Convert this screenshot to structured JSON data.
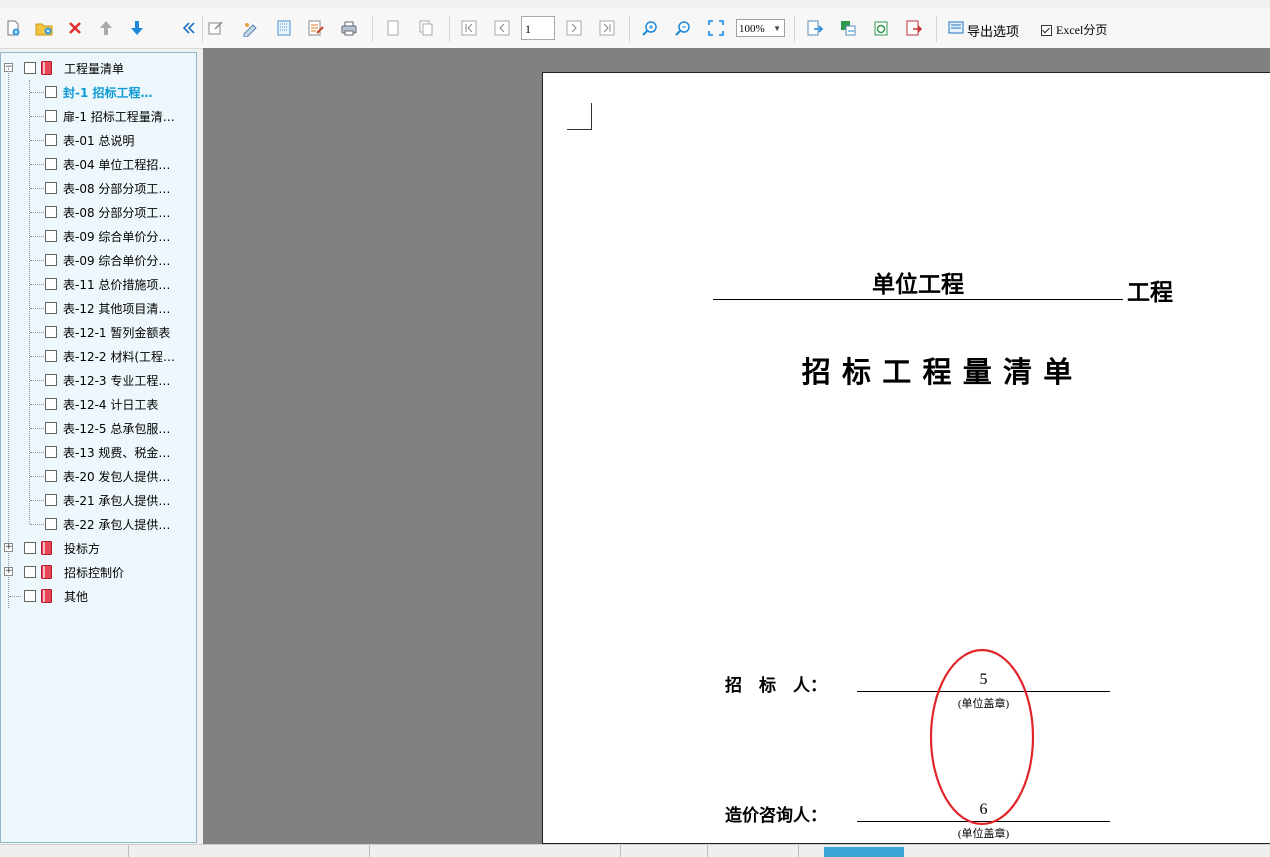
{
  "toolbar": {
    "page_number": "1",
    "zoom": "100%",
    "export_options_label": "导出选项",
    "excel_paging_label": "Excel分页",
    "excel_paging_checked": true
  },
  "tree": {
    "root": {
      "label": "工程量清单",
      "expanded": true
    },
    "items": [
      {
        "label": "封-1 招标工程…",
        "selected": true
      },
      {
        "label": "扉-1 招标工程量清…"
      },
      {
        "label": "表-01 总说明"
      },
      {
        "label": "表-04 单位工程招…"
      },
      {
        "label": "表-08 分部分项工…"
      },
      {
        "label": "表-08 分部分项工…"
      },
      {
        "label": "表-09 综合单价分…"
      },
      {
        "label": "表-09 综合单价分…"
      },
      {
        "label": "表-11 总价措施项…"
      },
      {
        "label": "表-12 其他项目清…"
      },
      {
        "label": "表-12-1 暂列金额表"
      },
      {
        "label": "表-12-2 材料(工程…"
      },
      {
        "label": "表-12-3 专业工程…"
      },
      {
        "label": "表-12-4 计日工表"
      },
      {
        "label": "表-12-5 总承包服…"
      },
      {
        "label": "表-13 规费、税金…"
      },
      {
        "label": "表-20 发包人提供…"
      },
      {
        "label": "表-21 承包人提供…"
      },
      {
        "label": "表-22 承包人提供…"
      }
    ],
    "groups": [
      {
        "label": "投标方",
        "expanded": false
      },
      {
        "label": "招标控制价",
        "expanded": false
      },
      {
        "label": "其他"
      }
    ]
  },
  "document": {
    "project_name": "单位工程",
    "project_suffix": "工程",
    "title": "招 标 工 程 量 清 单",
    "tenderer_label": "招    标    人：",
    "tenderer_value": "5",
    "consultant_label": "造价咨询人：",
    "consultant_value": "6",
    "seal_note": "(单位盖章)",
    "annotation_color": "#e0262a"
  }
}
